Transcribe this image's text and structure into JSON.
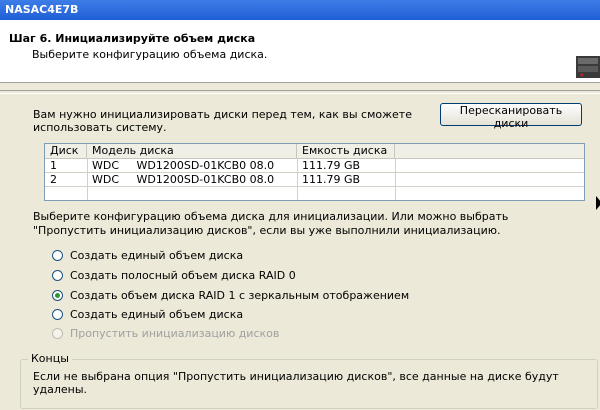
{
  "window": {
    "title": "NASAC4E7B"
  },
  "header": {
    "step_title": "Шаг 6. Инициализируйте объем диска",
    "step_subtitle": "Выберите конфигурацию объема диска."
  },
  "intro_text": "Вам нужно инициализировать диски перед тем, как вы сможете использовать систему.",
  "rescan_button": "Пересканировать диски",
  "disk_table": {
    "columns": [
      "Диск",
      "Модель диска",
      "Емкость диска"
    ],
    "rows": [
      {
        "disk": "1",
        "model": "WDC     WD1200SD-01KCB0 08.0",
        "capacity": "111.79 GB"
      },
      {
        "disk": "2",
        "model": "WDC     WD1200SD-01KCB0 08.0",
        "capacity": "111.79 GB"
      }
    ]
  },
  "config_text": "Выберите конфигурацию объема диска для инициализации.  Или можно выбрать \"Пропустить инициализацию дисков\", если вы уже выполнили инициализацию.",
  "options": [
    {
      "label": "Создать единый объем диска",
      "selected": false,
      "enabled": true
    },
    {
      "label": "Создать полосный объем диска RAID 0",
      "selected": false,
      "enabled": true
    },
    {
      "label": "Создать объем диска RAID 1 с зеркальным отображением",
      "selected": true,
      "enabled": true
    },
    {
      "label": "Создать единый объем диска",
      "selected": false,
      "enabled": true
    },
    {
      "label": "Пропустить инициализацию дисков",
      "selected": false,
      "enabled": false
    }
  ],
  "warning": {
    "legend": "Концы",
    "text": "Если не выбрана опция \"Пропустить инициализацию дисков\", все данные на диске будут удалены."
  }
}
